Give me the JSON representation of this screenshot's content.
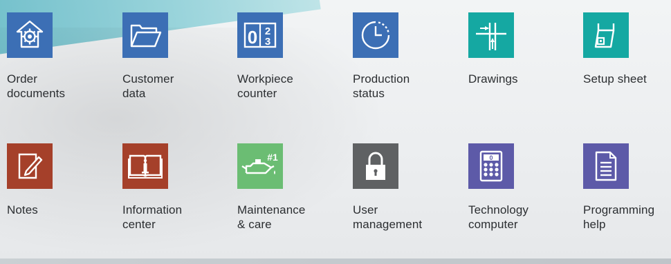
{
  "tiles": [
    {
      "name": "order-documents",
      "label": "Order\ndocuments",
      "icon": "gear-down-arrow-icon",
      "color": "#3c6fb5"
    },
    {
      "name": "customer-data",
      "label": "Customer\ndata",
      "icon": "folder-icon",
      "color": "#3c6fb5"
    },
    {
      "name": "workpiece-counter",
      "label": "Workpiece\ncounter",
      "icon": "counter-icon",
      "color": "#3c6fb5"
    },
    {
      "name": "production-status",
      "label": "Production\nstatus",
      "icon": "clock-icon",
      "color": "#3c6fb5"
    },
    {
      "name": "drawings",
      "label": "Drawings",
      "icon": "drawing-icon",
      "color": "#15a8a2"
    },
    {
      "name": "setup-sheet",
      "label": "Setup sheet",
      "icon": "setup-sheet-icon",
      "color": "#15a8a2"
    },
    {
      "name": "notes",
      "label": "Notes",
      "icon": "note-edit-icon",
      "color": "#a5402a"
    },
    {
      "name": "information-center",
      "label": "Information\ncenter",
      "icon": "info-book-icon",
      "color": "#a5402a"
    },
    {
      "name": "maintenance-care",
      "label": "Maintenance\n& care",
      "icon": "oil-can-icon",
      "color": "#6bbd73",
      "badge": "#1"
    },
    {
      "name": "user-management",
      "label": "User\nmanagement",
      "icon": "lock-icon",
      "color": "#5f6163"
    },
    {
      "name": "technology-computer",
      "label": "Technology\ncomputer",
      "icon": "calculator-icon",
      "color": "#5d5aa8",
      "display": "0"
    },
    {
      "name": "programming-help",
      "label": "Programming\nhelp",
      "icon": "document-icon",
      "color": "#5d5aa8"
    }
  ]
}
